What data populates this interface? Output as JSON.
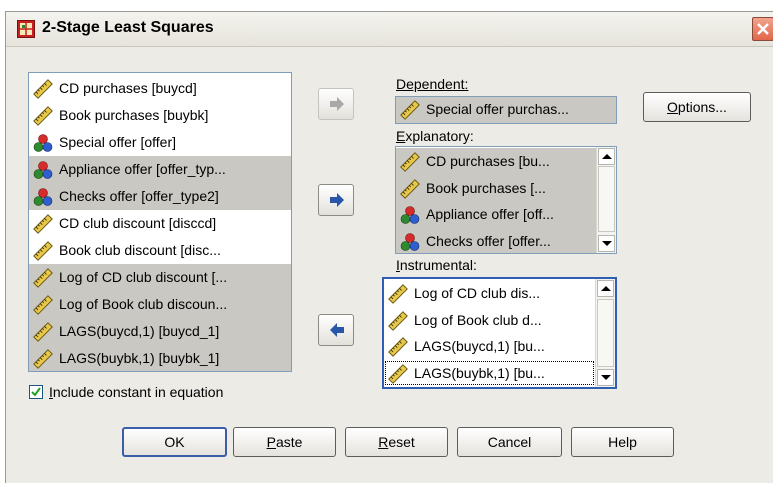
{
  "window": {
    "title": "2-Stage Least Squares"
  },
  "variables": [
    {
      "label": "CD purchases [buycd]",
      "icon": "scale-ruler-icon",
      "selected": false
    },
    {
      "label": "Book purchases [buybk]",
      "icon": "scale-ruler-icon",
      "selected": false
    },
    {
      "label": "Special offer [offer]",
      "icon": "nominal-balls-icon",
      "selected": false
    },
    {
      "label": "Appliance offer [offer_typ...",
      "icon": "nominal-balls-icon",
      "selected": true
    },
    {
      "label": "Checks offer [offer_type2]",
      "icon": "nominal-balls-icon",
      "selected": true
    },
    {
      "label": "CD club discount [disccd]",
      "icon": "scale-ruler-icon",
      "selected": false
    },
    {
      "label": "Book club discount [disc...",
      "icon": "scale-ruler-icon",
      "selected": false
    },
    {
      "label": "Log of CD club discount [...",
      "icon": "scale-ruler-icon",
      "selected": true
    },
    {
      "label": "Log of Book club discoun...",
      "icon": "scale-ruler-icon",
      "selected": true
    },
    {
      "label": "LAGS(buycd,1) [buycd_1]",
      "icon": "scale-ruler-icon",
      "selected": true
    },
    {
      "label": "LAGS(buybk,1) [buybk_1]",
      "icon": "scale-ruler-icon",
      "selected": true
    }
  ],
  "dependent": {
    "label": "Dependent:",
    "value": "Special offer purchas...",
    "icon": "scale-ruler-icon"
  },
  "explanatory": {
    "label": "Explanatory:",
    "items": [
      {
        "label": "CD purchases [bu...",
        "icon": "scale-ruler-icon"
      },
      {
        "label": "Book purchases [...",
        "icon": "scale-ruler-icon"
      },
      {
        "label": "Appliance offer [off...",
        "icon": "nominal-balls-icon"
      },
      {
        "label": "Checks offer [offer...",
        "icon": "nominal-balls-icon"
      }
    ]
  },
  "instrumental": {
    "label": "Instrumental:",
    "items": [
      {
        "label": "Log of CD club dis...",
        "icon": "scale-ruler-icon"
      },
      {
        "label": "Log of Book club d...",
        "icon": "scale-ruler-icon"
      },
      {
        "label": "LAGS(buycd,1) [bu...",
        "icon": "scale-ruler-icon"
      },
      {
        "label": "LAGS(buybk,1) [bu...",
        "icon": "scale-ruler-icon"
      }
    ]
  },
  "include_constant": {
    "label": "Include constant in equation",
    "checked": true
  },
  "buttons": {
    "options": "Options...",
    "ok": "OK",
    "paste": "Paste",
    "reset": "Reset",
    "cancel": "Cancel",
    "help": "Help"
  }
}
